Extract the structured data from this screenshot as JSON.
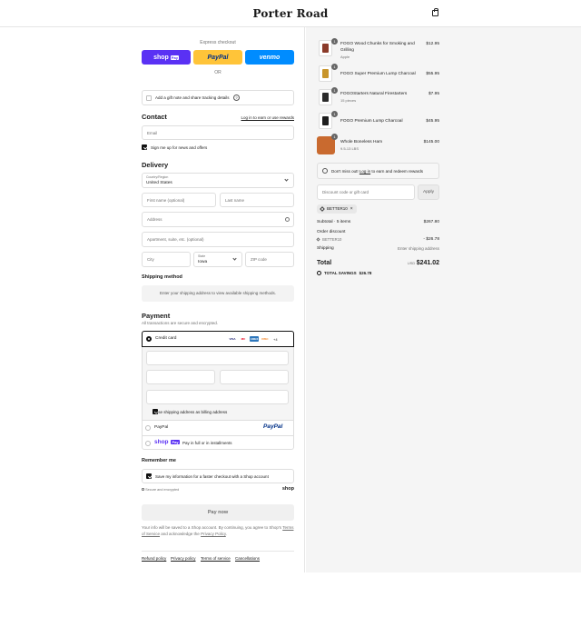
{
  "header": {
    "brand": "Porter Road"
  },
  "express": {
    "label": "Express checkout",
    "shop_label": "shop",
    "shop_tag": "Pay",
    "paypal_label": "PayPal",
    "venmo_label": "venmo",
    "or_label": "OR"
  },
  "gift": {
    "label": "Add a gift note and share tracking details",
    "help_icon": "?"
  },
  "contact": {
    "title": "Contact",
    "login_link": "Log in to earn or use rewards",
    "email_placeholder": "Email",
    "newsletter_label": "Sign me up for news and offers"
  },
  "delivery": {
    "title": "Delivery",
    "country_label": "Country/Region",
    "country_value": "United States",
    "first_name_placeholder": "First name (optional)",
    "last_name_placeholder": "Last name",
    "address_placeholder": "Address",
    "apartment_placeholder": "Apartment, suite, etc. (optional)",
    "city_placeholder": "City",
    "state_label": "State",
    "state_value": "Iowa",
    "zip_placeholder": "ZIP code"
  },
  "shipping": {
    "title": "Shipping method",
    "message": "Enter your shipping address to view available shipping methods."
  },
  "payment": {
    "title": "Payment",
    "subtitle": "All transactions are secure and encrypted.",
    "credit_card_label": "Credit card",
    "card_logos": [
      {
        "name": "VISA",
        "color": "#1a1f71"
      },
      {
        "name": "MC",
        "color": "#eb001b"
      },
      {
        "name": "AMEX",
        "color": "#2e77bc"
      },
      {
        "name": "DISC",
        "color": "#f58220"
      }
    ],
    "more_cards": "+4",
    "billing_label": "Use shipping address as billing address",
    "paypal_label": "PayPal",
    "paypal_logo": "PayPal",
    "shoppay_logo": "shop",
    "shoppay_tag": "Pay",
    "shoppay_label": "Pay in full or in installments"
  },
  "remember": {
    "title": "Remember me",
    "save_label": "Save my information for a faster checkout with a Shop account",
    "secure_label": "Secure and encrypted",
    "shop_mark": "shop"
  },
  "pay_now_label": "Pay now",
  "legal": {
    "line1": "Your info will be saved to a Shop account. By continuing, you agree to Shop's",
    "terms": "Terms of Service",
    "and_text": "and acknowledge the",
    "privacy": "Privacy Policy",
    "period": "."
  },
  "footer": {
    "links": [
      "Refund policy",
      "Privacy policy",
      "Terms of service",
      "Cancellations"
    ]
  },
  "cart": {
    "items": [
      {
        "qty": "1",
        "name": "FOGO Wood Chunks for Smoking and Grilling",
        "sub": "Apple",
        "price": "$12.95",
        "color": "#8b3b2a"
      },
      {
        "qty": "1",
        "name": "FOGO Super Premium Lump Charcoal",
        "sub": "",
        "price": "$55.95",
        "color": "#c8952b"
      },
      {
        "qty": "1",
        "name": "FOGOStarters Natural Firestarters",
        "sub": "15 pieces",
        "price": "$7.95",
        "color": "#2b2b2b"
      },
      {
        "qty": "1",
        "name": "FOGO Premium Lump Charcoal",
        "sub": "",
        "price": "$45.95",
        "color": "#1e1e1e"
      },
      {
        "qty": "1",
        "name": "Whole Boneless Ham",
        "sub": "9.5-13 LBS",
        "price": "$145.00",
        "color": "#c96a2f"
      }
    ],
    "rewards_text_pre": "Don't miss out!",
    "rewards_link": "Log in",
    "rewards_text_post": "to earn and redeem rewards",
    "discount_placeholder": "Discount code or gift card",
    "apply_label": "Apply",
    "code_tag": "BETTER10",
    "subtotal_label": "Subtotal · 5 items",
    "subtotal_value": "$267.80",
    "order_discount_label": "Order discount",
    "discount_code": "BETTER10",
    "discount_value": "- $26.78",
    "shipping_label": "Shipping",
    "shipping_value": "Enter shipping address",
    "total_label": "Total",
    "currency": "USD",
    "total_value": "$241.02",
    "savings_label": "TOTAL SAVINGS",
    "savings_value": "$26.78"
  }
}
